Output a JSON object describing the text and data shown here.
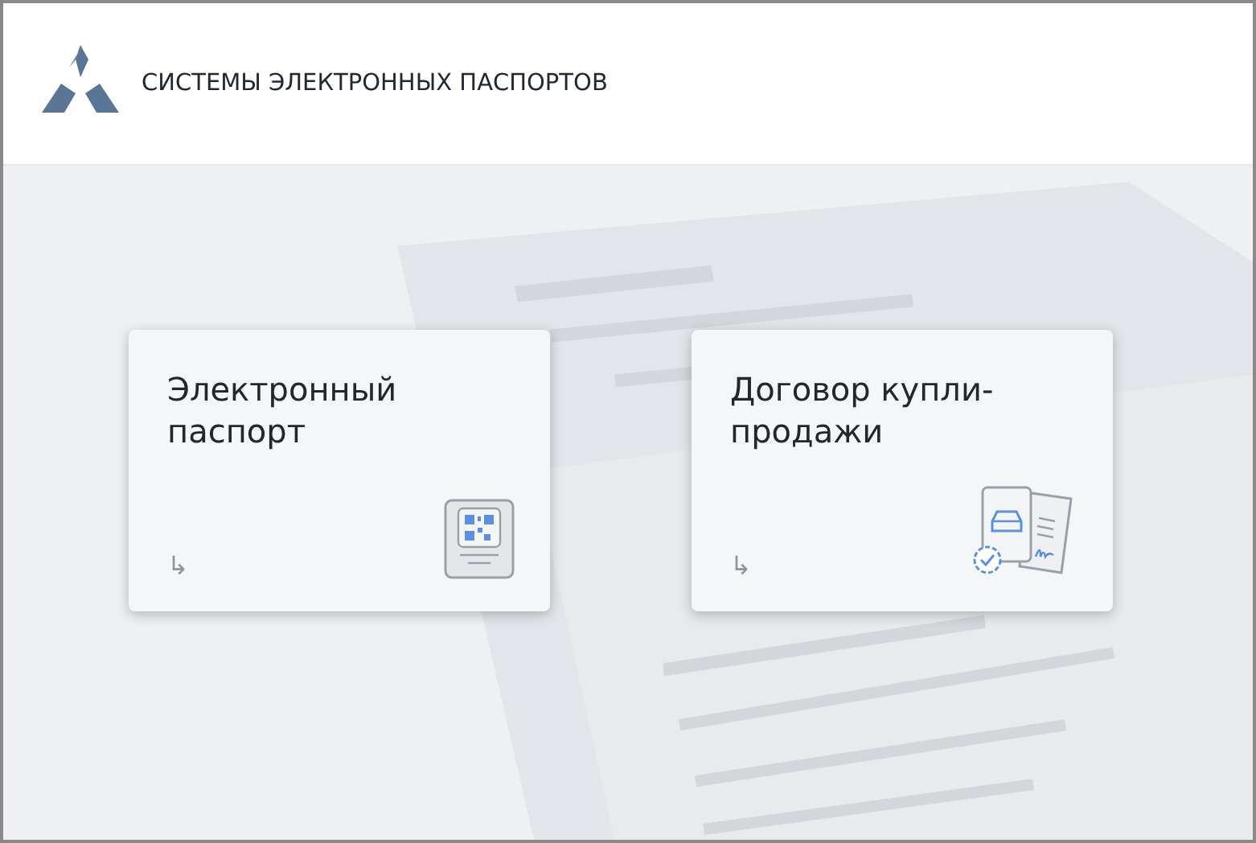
{
  "header": {
    "title": "СИСТЕМЫ ЭЛЕКТРОННЫХ ПАСПОРТОВ"
  },
  "cards": [
    {
      "kind": "passport",
      "title": "Электронный паспорт",
      "arrow": "↳"
    },
    {
      "kind": "contract",
      "title": "Договор купли-продажи",
      "arrow": "↳"
    }
  ]
}
